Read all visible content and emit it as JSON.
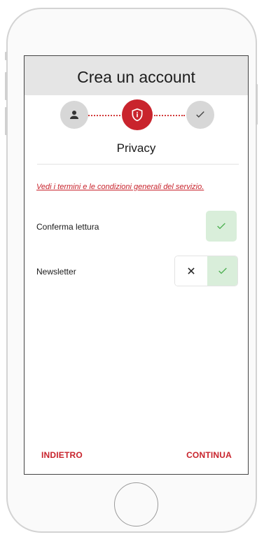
{
  "header": {
    "title": "Crea un account"
  },
  "stepper": {
    "steps": [
      {
        "name": "profile",
        "icon": "person-icon",
        "state": "inactive"
      },
      {
        "name": "privacy",
        "icon": "shield-icon",
        "state": "active"
      },
      {
        "name": "confirm",
        "icon": "check-icon",
        "state": "inactive"
      }
    ],
    "active_label": "Privacy"
  },
  "terms": {
    "link_text": "Vedi i termini e le condizioni generali del servizio."
  },
  "options": {
    "confirm_reading": {
      "label": "Conferma lettura",
      "value": true
    },
    "newsletter": {
      "label": "Newsletter",
      "value": true
    }
  },
  "footer": {
    "back_label": "INDIETRO",
    "continue_label": "CONTINUA"
  },
  "colors": {
    "accent": "#c9242d",
    "header_bg": "#e5e5e5",
    "step_inactive": "#d7d7d7",
    "check_bg": "#d9eeda",
    "check": "#5cb85c"
  }
}
